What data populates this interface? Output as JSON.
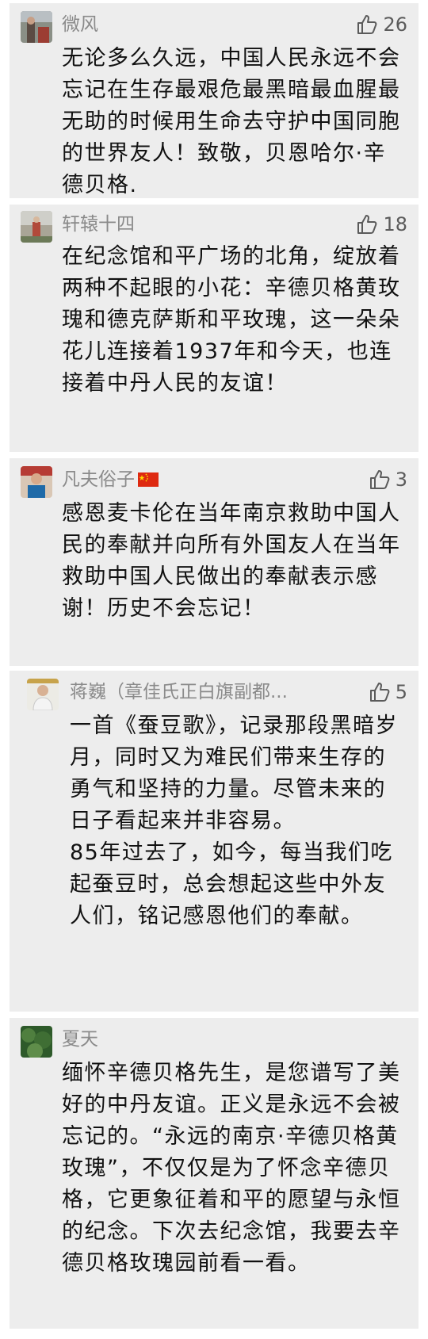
{
  "comments": [
    {
      "name": "微风",
      "likes": "26",
      "text": "无论多么久远，中国人民永远不会忘记在生存最艰危最黑暗最血腥最无助的时候用生命去守护中国同胞的世界友人！致敬，贝恩哈尔·辛德贝格."
    },
    {
      "name": "轩辕十四",
      "likes": "18",
      "text": "在纪念馆和平广场的北角，绽放着两种不起眼的小花：辛德贝格黄玫瑰和德克萨斯和平玫瑰，这一朵朵花儿连接着1937年和今天，也连接着中丹人民的友谊！"
    },
    {
      "name": "凡夫俗子",
      "likes": "3",
      "text": "感恩麦卡伦在当年南京救助中国人民的奉献并向所有外国友人在当年救助中国人民做出的奉献表示感谢！历史不会忘记！"
    },
    {
      "name": "蒋巍（章佳氏正白旗副都...",
      "likes": "5",
      "text_p1": "一首《蚕豆歌》，记录那段黑暗岁月，同时又为难民们带来生存的勇气和坚持的力量。尽管未来的日子看起来并非容易。",
      "text_p2": "85年过去了，如今，每当我们吃起蚕豆时，总会想起这些中外友人们，铭记感恩他们的奉献。"
    },
    {
      "name": "夏天",
      "text": "缅怀辛德贝格先生，是您谱写了美好的中丹友谊。正义是永远不会被忘记的。“永远的南京·辛德贝格黄玫瑰”，不仅仅是为了怀念辛德贝格，它更象征着和平的愿望与永恒的纪念。下次去纪念馆，我要去辛德贝格玫瑰园前看一看。"
    }
  ]
}
